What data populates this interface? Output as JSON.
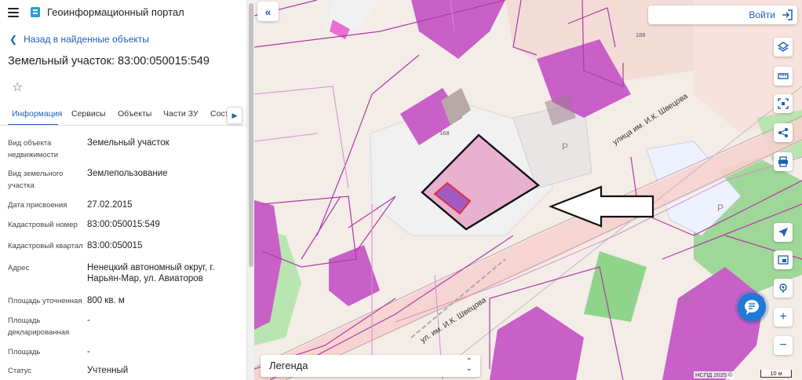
{
  "app": {
    "title": "Геоинформационный портал"
  },
  "nav": {
    "back_label": "Назад в найденные объекты"
  },
  "object": {
    "title": "Земельный участок: 83:00:050015:549"
  },
  "tabs": [
    "Информация",
    "Сервисы",
    "Объекты",
    "Части ЗУ",
    "Соста"
  ],
  "properties": [
    {
      "label": "Вид объекта недвижимости",
      "value": "Земельный участок"
    },
    {
      "label": "Вид земельного участка",
      "value": "Землепользование"
    },
    {
      "label": "Дата присвоения",
      "value": "27.02.2015"
    },
    {
      "label": "Кадастровый номер",
      "value": "83:00:050015:549"
    },
    {
      "label": "Кадастровый квартал",
      "value": "83:00:050015"
    },
    {
      "label": "Адрес",
      "value": "Ненецкий автономный округ, г. Нарьян-Мар, ул. Авиаторов"
    },
    {
      "label": "Площадь уточненная",
      "value": "800 кв. м"
    },
    {
      "label": "Площадь декларированная",
      "value": "-"
    },
    {
      "label": "Площадь",
      "value": "-"
    },
    {
      "label": "Статус",
      "value": "Учтенный"
    }
  ],
  "map": {
    "login_label": "Войти",
    "legend_label": "Легенда",
    "copyright": "НСПД 2025 ©",
    "scale_label": "10 м",
    "street_label_1": "улица им. И.К. Швецова",
    "street_label_2": "ул. им. И.К. Швецова",
    "building_numbers": [
      "186",
      "168"
    ],
    "parking_label": "Р",
    "colors": {
      "accent": "#1c5fb8",
      "parcel_fill": "#e5aacb",
      "building": "#c860c8",
      "highlight": "#e0303a",
      "green": "#8fd48a"
    }
  },
  "icons": [
    "menu-icon",
    "logo-icon",
    "chevron-left-icon",
    "star-icon",
    "chevron-right-icon",
    "double-chevron-left-icon",
    "login-icon",
    "layers-icon",
    "ruler-icon",
    "select-area-icon",
    "share-icon",
    "print-icon",
    "locate-icon",
    "minimap-icon",
    "pin-icon",
    "plus-icon",
    "minus-icon",
    "chat-icon",
    "dropdown-arrows-icon"
  ]
}
